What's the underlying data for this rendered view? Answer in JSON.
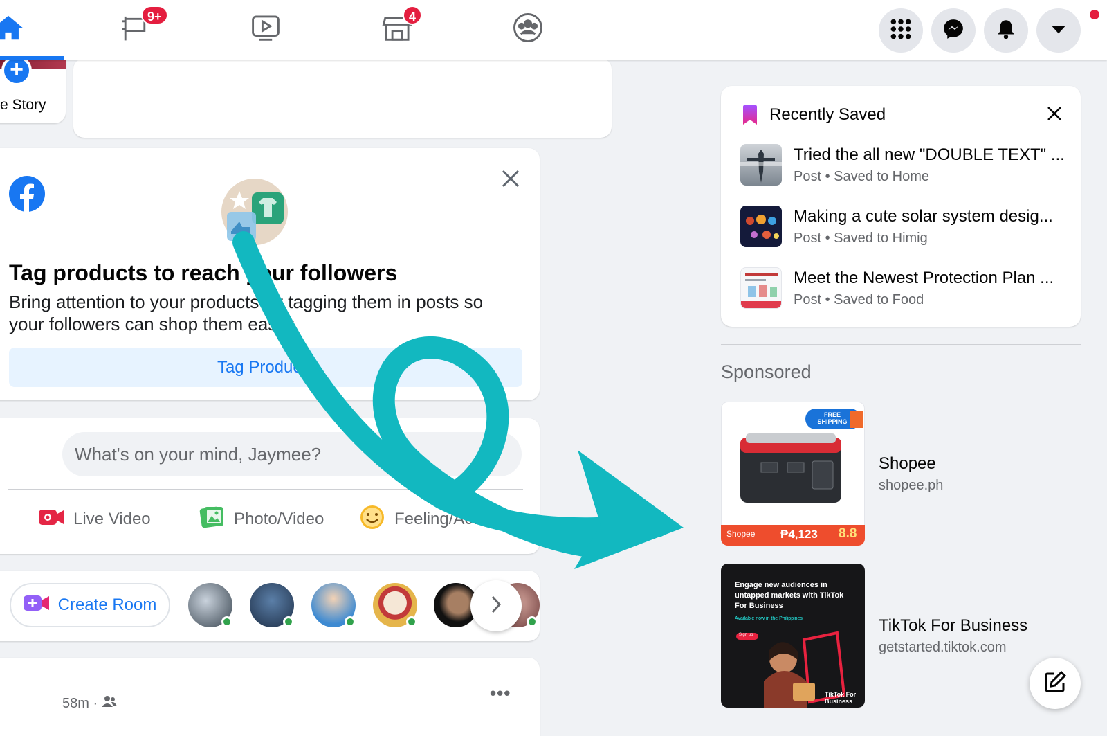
{
  "nav": {
    "groups_badge": "9+",
    "marketplace_badge": "4"
  },
  "stories": {
    "create_label": "e Story"
  },
  "tag_products": {
    "title": "Tag products to reach your followers",
    "description": "Bring attention to your products by tagging them in posts so your followers can shop them easily.",
    "button_label": "Tag Products"
  },
  "composer": {
    "placeholder": "What's on your mind, Jaymee?",
    "actions": [
      {
        "label": "Live Video",
        "icon": "live-video-icon"
      },
      {
        "label": "Photo/Video",
        "icon": "photo-video-icon"
      },
      {
        "label": "Feeling/Activity",
        "icon": "feeling-icon"
      }
    ]
  },
  "rooms": {
    "create_label": "Create Room"
  },
  "post": {
    "time": "58m ·",
    "more": "•••"
  },
  "recently_saved": {
    "title": "Recently Saved",
    "items": [
      {
        "title": "Tried the all new \"DOUBLE TEXT\" ...",
        "meta": "Post • Saved to Home"
      },
      {
        "title": "Making a cute solar system desig...",
        "meta": "Post • Saved to Himig"
      },
      {
        "title": "Meet the Newest Protection Plan ...",
        "meta": "Post • Saved to Food"
      }
    ]
  },
  "sponsored": {
    "heading": "Sponsored",
    "ads": [
      {
        "name": "Shopee",
        "url": "shopee.ph",
        "image_text": {
          "badge": "FREE SHIPPING",
          "brand": "Shopee",
          "price": "₱4,123",
          "sale": "8.8"
        }
      },
      {
        "name": "TikTok For Business",
        "url": "getstarted.tiktok.com",
        "image_text": {
          "headline": "Engage new audiences in untapped markets with TikTok For Business",
          "sub": "Available now in the Philippines",
          "cta": "Sign up",
          "brand": "TikTok For Business"
        }
      }
    ]
  },
  "colors": {
    "brand_blue": "#1877f2",
    "badge_red": "#e41e3f",
    "arrow_teal": "#12b8c0"
  }
}
